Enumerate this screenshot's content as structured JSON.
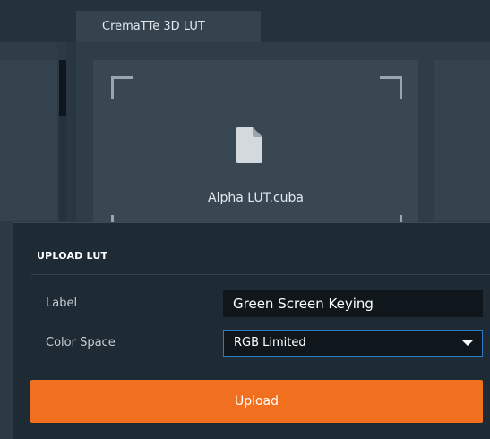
{
  "tab": {
    "title": "CremaTTe 3D LUT"
  },
  "file": {
    "name": "Alpha LUT.cuba",
    "icon": "file-icon"
  },
  "popup": {
    "title": "UPLOAD LUT",
    "label_field": {
      "label": "Label",
      "value": "Green Screen Keying"
    },
    "color_space_field": {
      "label": "Color Space",
      "selected": "RGB Limited"
    },
    "upload_label": "Upload"
  },
  "colors": {
    "accent": "#f07020",
    "focus_border": "#2f78c8",
    "popup_bg": "#1e2a34",
    "input_bg": "#0f171d"
  }
}
